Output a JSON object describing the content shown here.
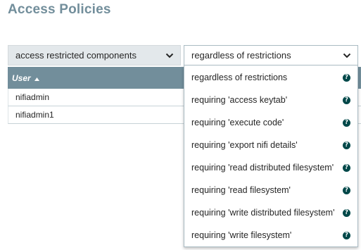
{
  "page": {
    "title": "Access Policies"
  },
  "policy_select": {
    "value": "access restricted components"
  },
  "restriction_select": {
    "value": "regardless of restrictions",
    "options": [
      "regardless of restrictions",
      "requiring 'access keytab'",
      "requiring 'execute code'",
      "requiring 'export nifi details'",
      "requiring 'read distributed filesystem'",
      "requiring 'read filesystem'",
      "requiring 'write distributed filesystem'",
      "requiring 'write filesystem'"
    ],
    "option_icon": "help-icon"
  },
  "table": {
    "column_user": "User",
    "sort_direction": "ascending",
    "rows": [
      "nifiadmin",
      "nifiadmin1"
    ]
  },
  "colors": {
    "title": "#728e9b",
    "header_bg": "#728e9b",
    "select_bg": "#e3e8eb",
    "help_icon": "#004849"
  }
}
